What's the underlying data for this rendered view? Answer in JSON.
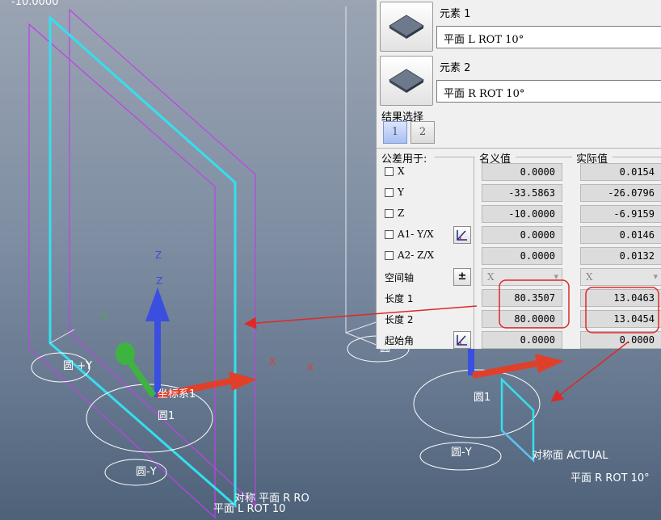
{
  "viewport": {
    "top_readout": "-10.0000",
    "labels": {
      "circle_plus_y": "圆 +Y",
      "circle1_left": "圆1",
      "circle_minus_y_left": "圆-Y",
      "coord_sys": "坐标系1",
      "plane_l": "平面 L ROT 10",
      "symmetry_r": "对称 平面 R RO",
      "circle1_right": "圆1",
      "circle_minus_y_right": "圆-Y",
      "symmetry_actual": "对称面 ACTUAL",
      "plane_r_rot": "平面 R ROT 10°",
      "small_circle": "圆"
    },
    "axes": {
      "z": "Z",
      "x": "X",
      "y": "Y"
    },
    "colors": {
      "cyan": "#33e0ee",
      "magenta": "#c040e8",
      "red_arrow": "#e02828",
      "axis_blue": "#3a4fe0",
      "axis_green": "#3fb33f",
      "axis_red": "#e0402a"
    }
  },
  "panel": {
    "element1": {
      "title": "元素 1",
      "value": "平面 L ROT 10°",
      "icon": "plane-icon"
    },
    "element2": {
      "title": "元素 2",
      "value": "平面 R ROT 10°",
      "icon": "plane-icon"
    },
    "result_select": {
      "label": "结果选择",
      "buttons": [
        "1",
        "2"
      ],
      "active": "1"
    },
    "headers": {
      "tolerance": "公差用于:",
      "nominal": "名义值",
      "actual": "实际值"
    },
    "rows": [
      {
        "label": "X",
        "checkbox": true,
        "nominal": "0.0000",
        "actual": "0.0154"
      },
      {
        "label": "Y",
        "checkbox": true,
        "nominal": "-33.5863",
        "actual": "-26.0796"
      },
      {
        "label": "Z",
        "checkbox": true,
        "nominal": "-10.0000",
        "actual": "-6.9159"
      },
      {
        "label": "A1- Y/X",
        "checkbox": true,
        "nominal": "0.0000",
        "actual": "0.0146",
        "tool": "angle-tool-icon"
      },
      {
        "label": "A2- Z/X",
        "checkbox": true,
        "nominal": "0.0000",
        "actual": "0.0132"
      }
    ],
    "space_axis": {
      "label": "空间轴",
      "tool_symbol": "±",
      "nominal": "X",
      "actual": "X"
    },
    "length_rows": [
      {
        "label": "长度 1",
        "nominal": "80.3507",
        "actual": "13.0463"
      },
      {
        "label": "长度 2",
        "nominal": "80.0000",
        "actual": "13.0454"
      }
    ],
    "start_angle": {
      "label": "起始角",
      "nominal": "0.0000",
      "actual": "0.0000",
      "tool": "angle-tool-icon"
    }
  }
}
